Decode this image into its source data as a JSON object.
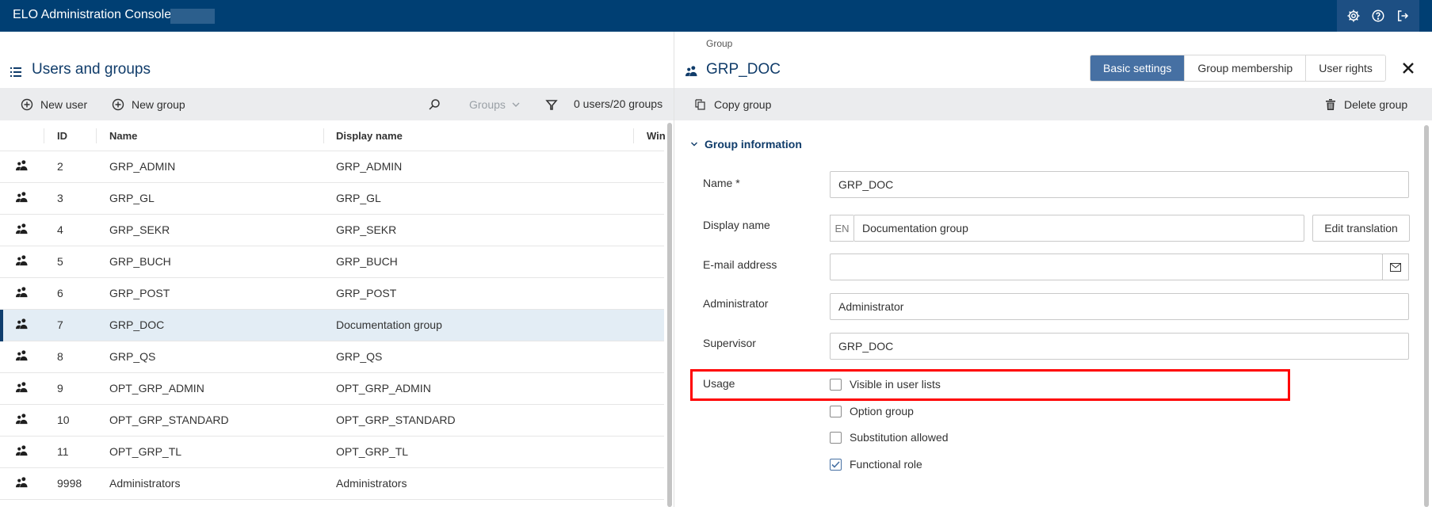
{
  "app": {
    "title": "ELO Administration Console"
  },
  "header_icons": [
    {
      "name": "settings-icon"
    },
    {
      "name": "help-icon"
    },
    {
      "name": "logout-icon"
    }
  ],
  "left": {
    "title": "Users and groups",
    "toolbar": {
      "new_user": "New user",
      "new_group": "New group",
      "filter_select": "Groups",
      "count": "0 users/20 groups"
    },
    "columns": [
      "ID",
      "Name",
      "Display name",
      "Win"
    ],
    "rows": [
      {
        "id": "2",
        "name": "GRP_ADMIN",
        "display": "GRP_ADMIN",
        "selected": false
      },
      {
        "id": "3",
        "name": "GRP_GL",
        "display": "GRP_GL",
        "selected": false
      },
      {
        "id": "4",
        "name": "GRP_SEKR",
        "display": "GRP_SEKR",
        "selected": false
      },
      {
        "id": "5",
        "name": "GRP_BUCH",
        "display": "GRP_BUCH",
        "selected": false
      },
      {
        "id": "6",
        "name": "GRP_POST",
        "display": "GRP_POST",
        "selected": false
      },
      {
        "id": "7",
        "name": "GRP_DOC",
        "display": "Documentation group",
        "selected": true
      },
      {
        "id": "8",
        "name": "GRP_QS",
        "display": "GRP_QS",
        "selected": false
      },
      {
        "id": "9",
        "name": "OPT_GRP_ADMIN",
        "display": "OPT_GRP_ADMIN",
        "selected": false
      },
      {
        "id": "10",
        "name": "OPT_GRP_STANDARD",
        "display": "OPT_GRP_STANDARD",
        "selected": false
      },
      {
        "id": "11",
        "name": "OPT_GRP_TL",
        "display": "OPT_GRP_TL",
        "selected": false
      },
      {
        "id": "9998",
        "name": "Administrators",
        "display": "Administrators",
        "selected": false
      }
    ]
  },
  "right": {
    "breadcrumb": "Group",
    "title": "GRP_DOC",
    "tabs": [
      {
        "label": "Basic settings",
        "active": true
      },
      {
        "label": "Group membership",
        "active": false
      },
      {
        "label": "User rights",
        "active": false
      }
    ],
    "toolbar": {
      "copy": "Copy group",
      "delete": "Delete group"
    },
    "section": "Group information",
    "form": {
      "name_label": "Name *",
      "name_value": "GRP_DOC",
      "display_label": "Display name",
      "display_lang": "EN",
      "display_value": "Documentation group",
      "edit_translation": "Edit translation",
      "email_label": "E-mail address",
      "email_value": "",
      "admin_label": "Administrator",
      "admin_value": "Administrator",
      "supervisor_label": "Supervisor",
      "supervisor_value": "GRP_DOC",
      "usage_label": "Usage",
      "options": [
        {
          "label": "Visible in user lists",
          "checked": false
        },
        {
          "label": "Option group",
          "checked": false
        },
        {
          "label": "Substitution allowed",
          "checked": false
        },
        {
          "label": "Functional role",
          "checked": true
        }
      ]
    }
  },
  "colors": {
    "header_bg": "#003f73",
    "accent": "#4670a3",
    "title_text": "#103c6a",
    "selection_bg": "#e3edf5",
    "highlight": "#ff0000"
  }
}
